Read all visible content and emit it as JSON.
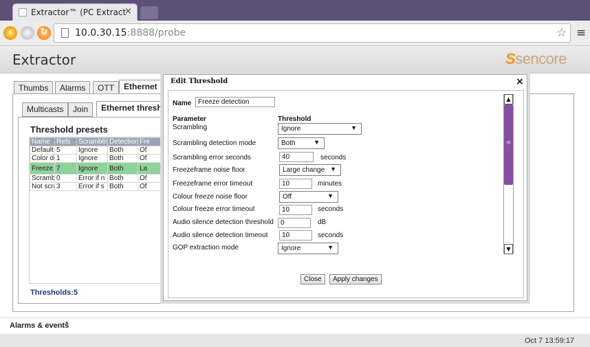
{
  "browser": {
    "tab_title": "Extractor™ (PC Extract",
    "tab_close": "×",
    "url_host": "10.0.30.15",
    "url_rest": ":8888/probe",
    "star_icon": "☆",
    "menu_icon": "≡"
  },
  "app": {
    "title": "Extractor",
    "logo_mark": "S",
    "logo_text": "sencore"
  },
  "top_tabs": [
    "Thumbs",
    "Alarms",
    "OTT",
    "Ethernet"
  ],
  "sub_tabs": [
    "Multicasts",
    "Join",
    "Ethernet thresh."
  ],
  "presets": {
    "title": "Threshold presets",
    "columns": [
      "Name",
      "Refs",
      "Scramblin",
      "Detection",
      "Fre"
    ],
    "rows": [
      [
        "Default",
        "5",
        "Ignore",
        "Both",
        "Of"
      ],
      [
        "Color det",
        "1",
        "Ignore",
        "Both",
        "Of"
      ],
      [
        "Freeze d",
        "7",
        "Ignore",
        "Both",
        "La"
      ],
      [
        "Scramble",
        "0",
        "Error if n",
        "Both",
        "Of"
      ],
      [
        "Not scrar",
        "3",
        "Error if s",
        "Both",
        "Of"
      ]
    ],
    "selected_row": 2,
    "footer": "Thresholds:5"
  },
  "dialog": {
    "title": "Edit Threshold",
    "close": "×",
    "name_label": "Name",
    "name_value": "Freeze detection",
    "col_parameter": "Parameter",
    "col_threshold": "Threshold",
    "params": [
      {
        "label": "Scrambling",
        "value": "Ignore",
        "unit": ""
      },
      {
        "label": "Scrambling detection mode",
        "value": "Both",
        "unit": ""
      },
      {
        "label": "Scrambling error seconds",
        "value": "40",
        "unit": "seconds"
      },
      {
        "label": "Freezeframe noise floor",
        "value": "Large change",
        "unit": ""
      },
      {
        "label": "Freezeframe error timeout",
        "value": "10",
        "unit": "minutes"
      },
      {
        "label": "Colour freeze noise floor",
        "value": "Off",
        "unit": ""
      },
      {
        "label": "Colour freeze error timeout",
        "value": "10",
        "unit": "seconds"
      },
      {
        "label": "Audio silence detection threshold",
        "value": "0",
        "unit": "dB"
      },
      {
        "label": "Audio silence detection timeout",
        "value": "10",
        "unit": "seconds"
      },
      {
        "label": "GOP extraction mode",
        "value": "Ignore",
        "unit": ""
      }
    ],
    "close_button": "Close",
    "apply_button": "Apply changes"
  },
  "footer": {
    "alarms_events": "Alarms & events",
    "clock": "Oct 7 13:59:17"
  },
  "colors": {
    "titlebar": "#5e4f78",
    "accent_selected_row": "#8fd29a",
    "scroll_thumb": "#8350a3",
    "logo_orange": "#f7941d"
  }
}
